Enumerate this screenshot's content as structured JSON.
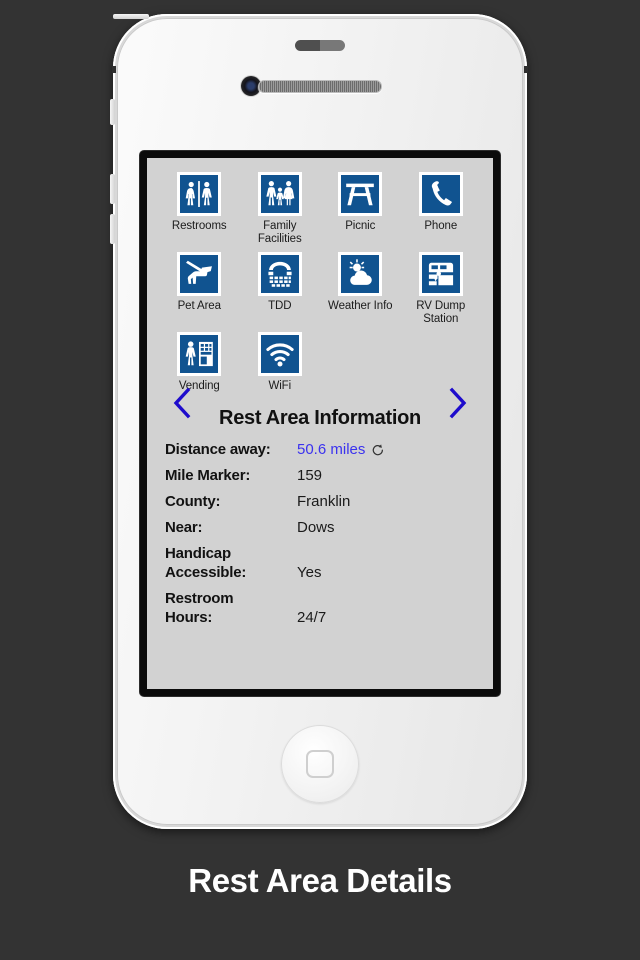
{
  "caption": "Rest Area Details",
  "device": {
    "home_button": "home-button",
    "camera": "front-camera",
    "speaker": "earpiece-speaker"
  },
  "screen": {
    "amenities": [
      {
        "label": "Restrooms",
        "icon": "restrooms-icon"
      },
      {
        "label": "Family\nFacilities",
        "icon": "family-facilities-icon"
      },
      {
        "label": "Picnic",
        "icon": "picnic-icon"
      },
      {
        "label": "Phone",
        "icon": "phone-icon"
      },
      {
        "label": "Pet Area",
        "icon": "pet-area-icon"
      },
      {
        "label": "TDD",
        "icon": "tdd-icon"
      },
      {
        "label": "Weather Info",
        "icon": "weather-info-icon"
      },
      {
        "label": "RV Dump\nStation",
        "icon": "rv-dump-station-icon"
      },
      {
        "label": "Vending",
        "icon": "vending-icon"
      },
      {
        "label": "WiFi",
        "icon": "wifi-icon"
      }
    ],
    "nav": {
      "prev": "chevron-left-icon",
      "next": "chevron-right-icon"
    },
    "info": {
      "title": "Rest Area Information",
      "rows": [
        {
          "label": "Distance away:",
          "value": "50.6 miles",
          "link": true,
          "refresh": true
        },
        {
          "label": "Mile Marker:",
          "value": "159",
          "link": false,
          "refresh": false
        },
        {
          "label": "County:",
          "value": "Franklin",
          "link": false,
          "refresh": false
        },
        {
          "label": "Near:",
          "value": "Dows",
          "link": false,
          "refresh": false
        },
        {
          "label": "Handicap\nAccessible:",
          "value": "Yes",
          "link": false,
          "refresh": false
        },
        {
          "label": "Restroom\nHours:",
          "value": "24/7",
          "link": false,
          "refresh": false
        }
      ]
    }
  },
  "colors": {
    "sign_blue": "#105390",
    "link_blue": "#3b32ef",
    "arrow_blue": "#1e0ccc",
    "screen_bg": "#d2d2d2",
    "page_bg": "#333333"
  }
}
